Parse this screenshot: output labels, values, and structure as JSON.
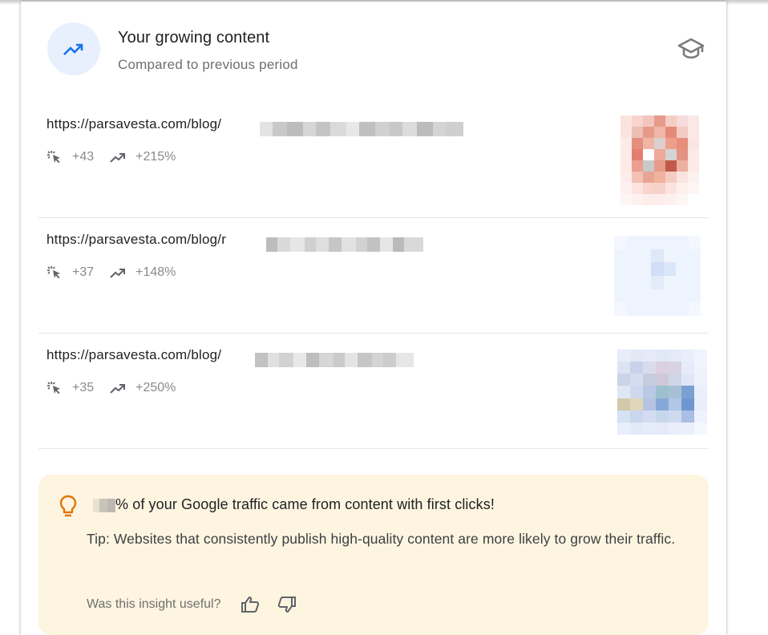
{
  "header": {
    "title": "Your growing content",
    "subtitle": "Compared to previous period",
    "trend_icon": "trending-up-icon",
    "learn_icon": "school-icon",
    "accent_color": "#1a73e8"
  },
  "items": [
    {
      "url": "https://parsavesta.com/blog/",
      "clicks": "+43",
      "growth": "+215%"
    },
    {
      "url": "https://parsavesta.com/blog/r",
      "clicks": "+37",
      "growth": "+148%"
    },
    {
      "url": "https://parsavesta.com/blog/",
      "clicks": "+35",
      "growth": "+250%"
    }
  ],
  "tip": {
    "headline": "% of your Google traffic came from content with first clicks!",
    "body": "Tip: Websites that consistently publish high-quality content are more likely to grow their traffic.",
    "question": "Was this insight useful?",
    "background": "#fef5e0",
    "bulb_color": "#e37400"
  }
}
